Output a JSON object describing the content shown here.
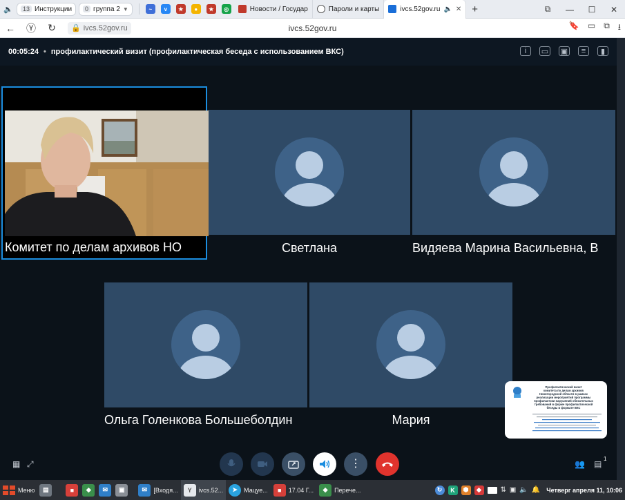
{
  "browser": {
    "tab_groups": [
      {
        "count": "13",
        "label": "Инструкции"
      },
      {
        "count": "0",
        "label": "группа 2"
      }
    ],
    "tabs": [
      {
        "label": "Новости / Государ"
      },
      {
        "label": "Пароли и карты"
      },
      {
        "label": "ivcs.52gov.ru"
      }
    ],
    "url_short": "ivcs.52gov.ru",
    "page_host": "ivcs.52gov.ru"
  },
  "conference": {
    "timer": "00:05:24",
    "title": "профилактический визит (профилактическая беседа с использованием ВКС)"
  },
  "participants": [
    {
      "name": "Комитет по делам архивов НО"
    },
    {
      "name": "Светлана"
    },
    {
      "name": "Видяева Марина Васильевна, В"
    },
    {
      "name": "Ольга Голенкова Большеболдин"
    },
    {
      "name": "Мария"
    }
  ],
  "slide_preview": {
    "lines": [
      "Профилактический визит",
      "комитета по делам архивов",
      "Нижегородской области в рамках",
      "реализации мероприятий программы",
      "профилактики нарушений обязательных",
      "требований в форме профилактической",
      "беседы в формате ВКС"
    ]
  },
  "chat_badge": "1",
  "taskbar": {
    "menu_label": "Меню",
    "apps": [
      {
        "label": "[Входя..."
      },
      {
        "label": "ivcs.52..."
      },
      {
        "label": "Мацуе..."
      },
      {
        "label": "17.04 Г..."
      },
      {
        "label": "Перече..."
      }
    ],
    "clock": "Четверг апреля 11, 10:06"
  }
}
